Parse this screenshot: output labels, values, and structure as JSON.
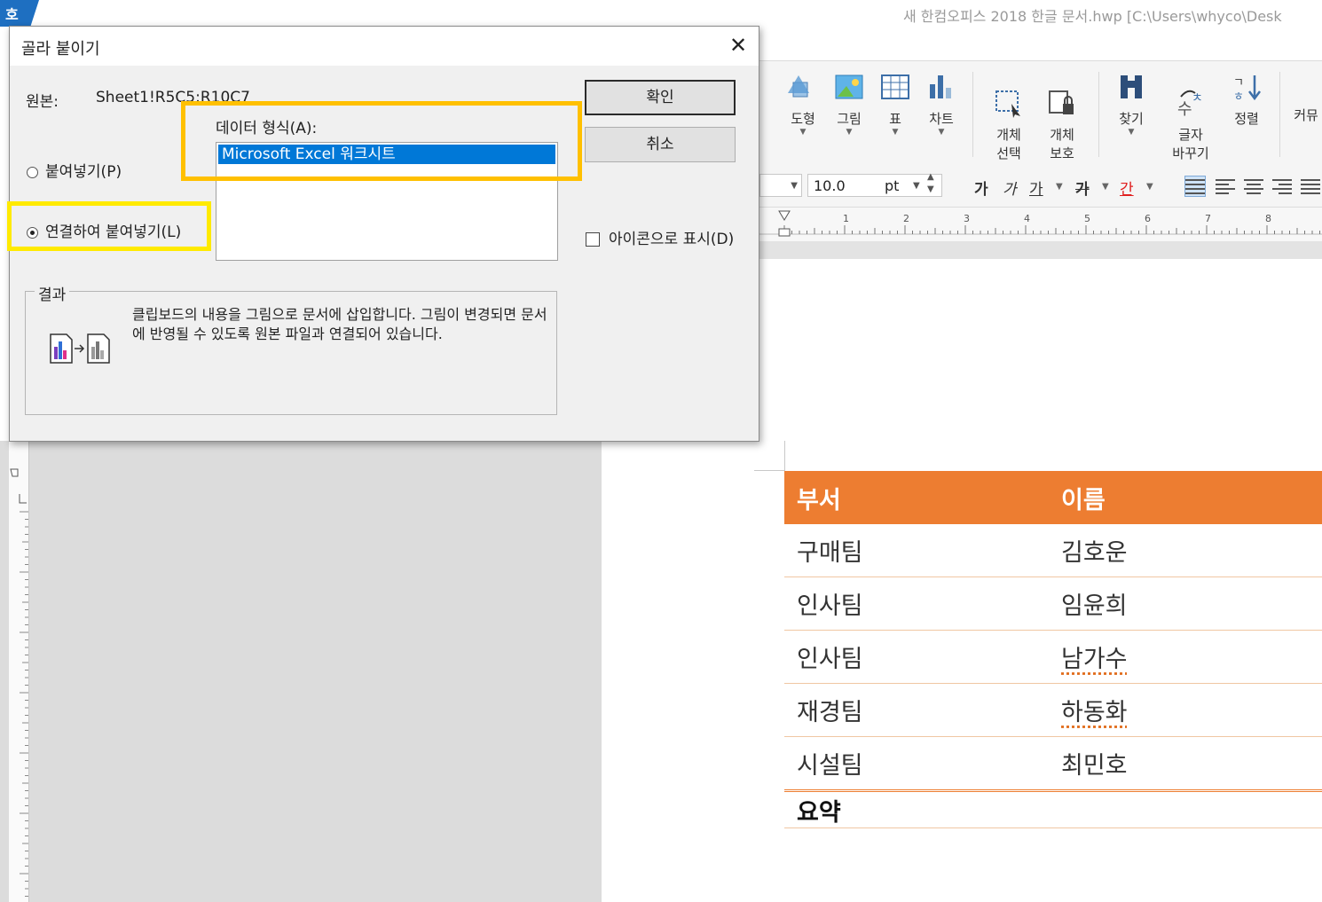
{
  "window": {
    "app_icon_glyph": "호",
    "title": "새 한컴오피스 2018 한글 문서.hwp [C:\\Users\\whyco\\Desk"
  },
  "ribbon": {
    "items": [
      {
        "label": "도형",
        "icon": "shape-icon"
      },
      {
        "label": "그림",
        "icon": "picture-icon"
      },
      {
        "label": "표",
        "icon": "table-icon"
      },
      {
        "label": "차트",
        "icon": "chart-icon"
      },
      {
        "label": "개체\n선택",
        "icon": "select-object-icon"
      },
      {
        "label": "개체\n보호",
        "icon": "protect-object-icon"
      },
      {
        "label": "찾기",
        "icon": "binoculars-icon"
      },
      {
        "label": "글자\n바꾸기",
        "icon": "replace-text-icon"
      },
      {
        "label": "정렬",
        "icon": "sort-icon"
      },
      {
        "label": "커뮤",
        "icon": "community-icon"
      }
    ]
  },
  "format_bar": {
    "font_size": "10.0",
    "unit": "pt",
    "bold_glyph": "가",
    "italic_glyph": "가",
    "underline_glyph": "가",
    "strike_glyph": "가",
    "color_glyph": "간"
  },
  "ruler": {
    "ticks": [
      "1",
      "2",
      "3",
      "4",
      "5",
      "6",
      "7",
      "8"
    ]
  },
  "doc_table": {
    "headers": [
      "부서",
      "이름"
    ],
    "rows": [
      [
        "구매팀",
        "김호운"
      ],
      [
        "인사팀",
        "임윤희"
      ],
      [
        "인사팀",
        "남가수"
      ],
      [
        "재경팀",
        "하동화"
      ],
      [
        "시설팀",
        "최민호"
      ]
    ],
    "summary_label": "요약",
    "header_color": "#ed7d31"
  },
  "dialog": {
    "title": "골라 붙이기",
    "source_label": "원본:",
    "source_value": "Sheet1!R5C5:R10C7",
    "data_format_label": "데이터 형식(A):",
    "formats": [
      "Microsoft Excel 워크시트"
    ],
    "paste_option": "붙여넣기(P)",
    "paste_link_option": "연결하여 붙여넣기(L)",
    "ok_label": "확인",
    "cancel_label": "취소",
    "show_icon_label": "아이콘으로 표시(D)",
    "result_label": "결과",
    "result_text": "클립보드의 내용을 그림으로 문서에 삽입합니다. 그림이 변경되면 문서에 반영될 수 있도록 원본 파일과 연결되어 있습니다.",
    "highlight_yellow": "#ffea00",
    "highlight_orange": "#ffc000"
  }
}
